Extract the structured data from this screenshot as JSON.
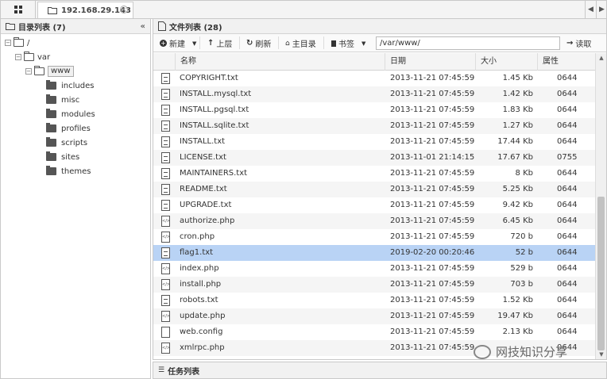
{
  "topbar": {
    "tab_label": "192.168.29.143",
    "tab_close": "×"
  },
  "dir_panel": {
    "title": "目录列表 (7)"
  },
  "tree": {
    "root": "/",
    "var": "var",
    "www": "www",
    "children": [
      "includes",
      "misc",
      "modules",
      "profiles",
      "scripts",
      "sites",
      "themes"
    ]
  },
  "file_panel": {
    "title": "文件列表 (28)"
  },
  "toolbar": {
    "new_label": "新建",
    "up_label": "上层",
    "refresh_label": "刷新",
    "home_label": "主目录",
    "bookmark_label": "书签",
    "path_value": "/var/www/",
    "read_label": "读取"
  },
  "columns": {
    "name": "名称",
    "date": "日期",
    "size": "大小",
    "attr": "属性"
  },
  "files": [
    {
      "name": "COPYRIGHT.txt",
      "date": "2013-11-21 07:45:59",
      "size": "1.45 Kb",
      "attr": "0644",
      "icon": "text-file-icon"
    },
    {
      "name": "INSTALL.mysql.txt",
      "date": "2013-11-21 07:45:59",
      "size": "1.42 Kb",
      "attr": "0644",
      "icon": "text-file-icon"
    },
    {
      "name": "INSTALL.pgsql.txt",
      "date": "2013-11-21 07:45:59",
      "size": "1.83 Kb",
      "attr": "0644",
      "icon": "text-file-icon"
    },
    {
      "name": "INSTALL.sqlite.txt",
      "date": "2013-11-21 07:45:59",
      "size": "1.27 Kb",
      "attr": "0644",
      "icon": "text-file-icon"
    },
    {
      "name": "INSTALL.txt",
      "date": "2013-11-21 07:45:59",
      "size": "17.44 Kb",
      "attr": "0644",
      "icon": "text-file-icon"
    },
    {
      "name": "LICENSE.txt",
      "date": "2013-11-01 21:14:15",
      "size": "17.67 Kb",
      "attr": "0755",
      "icon": "text-file-icon"
    },
    {
      "name": "MAINTAINERS.txt",
      "date": "2013-11-21 07:45:59",
      "size": "8 Kb",
      "attr": "0644",
      "icon": "text-file-icon"
    },
    {
      "name": "README.txt",
      "date": "2013-11-21 07:45:59",
      "size": "5.25 Kb",
      "attr": "0644",
      "icon": "text-file-icon"
    },
    {
      "name": "UPGRADE.txt",
      "date": "2013-11-21 07:45:59",
      "size": "9.42 Kb",
      "attr": "0644",
      "icon": "text-file-icon"
    },
    {
      "name": "authorize.php",
      "date": "2013-11-21 07:45:59",
      "size": "6.45 Kb",
      "attr": "0644",
      "icon": "code-file-icon"
    },
    {
      "name": "cron.php",
      "date": "2013-11-21 07:45:59",
      "size": "720 b",
      "attr": "0644",
      "icon": "code-file-icon"
    },
    {
      "name": "flag1.txt",
      "date": "2019-02-20 00:20:46",
      "size": "52 b",
      "attr": "0644",
      "icon": "text-file-icon",
      "selected": true
    },
    {
      "name": "index.php",
      "date": "2013-11-21 07:45:59",
      "size": "529 b",
      "attr": "0644",
      "icon": "code-file-icon"
    },
    {
      "name": "install.php",
      "date": "2013-11-21 07:45:59",
      "size": "703 b",
      "attr": "0644",
      "icon": "code-file-icon"
    },
    {
      "name": "robots.txt",
      "date": "2013-11-21 07:45:59",
      "size": "1.52 Kb",
      "attr": "0644",
      "icon": "text-file-icon"
    },
    {
      "name": "update.php",
      "date": "2013-11-21 07:45:59",
      "size": "19.47 Kb",
      "attr": "0644",
      "icon": "code-file-icon"
    },
    {
      "name": "web.config",
      "date": "2013-11-21 07:45:59",
      "size": "2.13 Kb",
      "attr": "0644",
      "icon": "blank-file-icon"
    },
    {
      "name": "xmlrpc.php",
      "date": "2013-11-21 07:45:59",
      "size": "",
      "attr": "0644",
      "icon": "code-file-icon"
    }
  ],
  "task_panel": {
    "title": "任务列表"
  },
  "watermark": {
    "text": "网技知识分享"
  },
  "colors": {
    "selected_row": "#b9d3f5",
    "alt_row": "#f5f5f5",
    "header_bg": "#f1f1f1"
  }
}
